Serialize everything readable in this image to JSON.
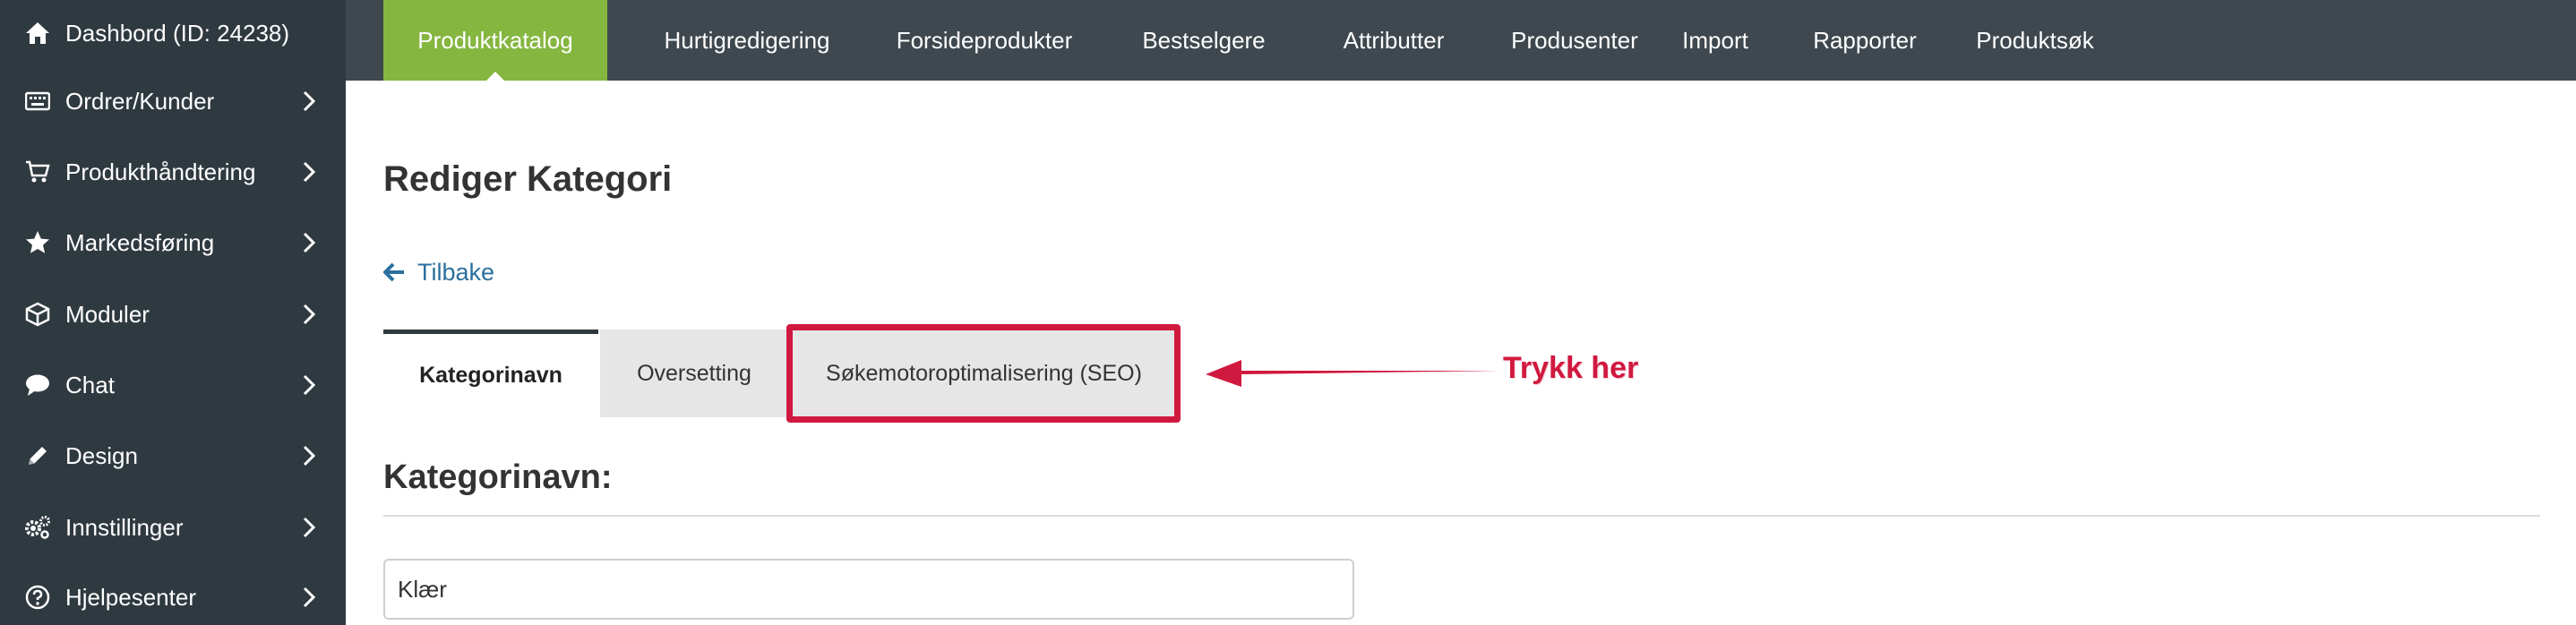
{
  "sidebar": {
    "items": [
      {
        "label": "Dashbord (ID: 24238)",
        "icon": "home-icon"
      },
      {
        "label": "Ordrer/Kunder",
        "icon": "keyboard-icon"
      },
      {
        "label": "Produkthåndtering",
        "icon": "cart-icon"
      },
      {
        "label": "Markedsføring",
        "icon": "star-icon"
      },
      {
        "label": "Moduler",
        "icon": "cube-icon"
      },
      {
        "label": "Chat",
        "icon": "chat-bubble-icon"
      },
      {
        "label": "Design",
        "icon": "pencil-icon"
      },
      {
        "label": "Innstillinger",
        "icon": "gears-icon"
      },
      {
        "label": "Hjelpesenter",
        "icon": "help-circle-icon"
      }
    ]
  },
  "topnav": {
    "tabs": [
      {
        "label": "Produktkatalog"
      },
      {
        "label": "Hurtigredigering"
      },
      {
        "label": "Forsideprodukter"
      },
      {
        "label": "Bestselgere"
      },
      {
        "label": "Attributter"
      },
      {
        "label": "Produsenter"
      },
      {
        "label": "Import"
      },
      {
        "label": "Rapporter"
      },
      {
        "label": "Produktsøk"
      }
    ]
  },
  "page": {
    "title": "Rediger Kategori",
    "back_label": "Tilbake",
    "tabs": [
      {
        "label": "Kategorinavn"
      },
      {
        "label": "Oversetting"
      },
      {
        "label": "Søkemotoroptimalisering (SEO)"
      }
    ],
    "annotation": "Trykk her",
    "section_title": "Kategorinavn:",
    "name_input_value": "Klær"
  },
  "colors": {
    "sidebar_bg": "#2f3a40",
    "topnav_bg": "#3e484e",
    "active_tab": "#85b640",
    "highlight": "#d0193f",
    "link": "#2b6f9e"
  }
}
